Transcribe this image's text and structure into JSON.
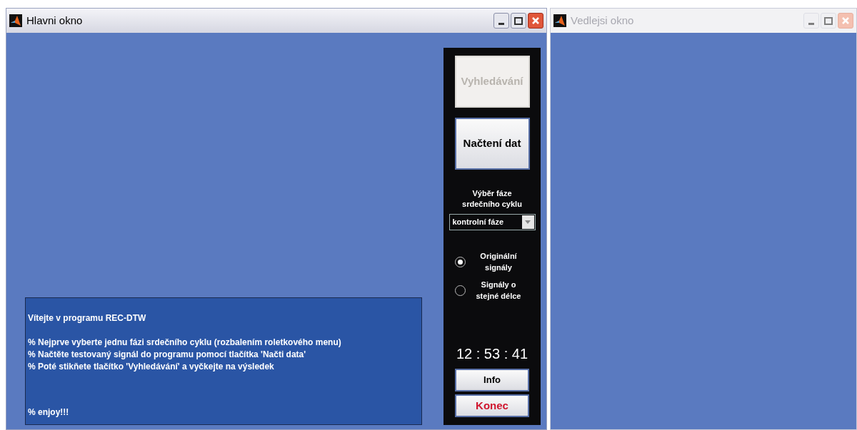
{
  "windows": [
    {
      "title": "Hlavni okno",
      "active": true
    },
    {
      "title": "Vedlejsi okno",
      "active": false
    }
  ],
  "panel": {
    "buttons": [
      {
        "label": "Vyhledávání",
        "disabled": true
      },
      {
        "label": "Načtení dat",
        "disabled": false
      }
    ],
    "phase_label": "Výběr fáze srdečního cyklu",
    "dropdown": {
      "value": "kontrolní fáze"
    },
    "radios": [
      {
        "label": "Originální signály",
        "selected": true
      },
      {
        "label": "Signály o stejné délce",
        "selected": false
      }
    ],
    "clock": "12 : 53 : 41",
    "info_button": "Info",
    "exit_button": "Konec"
  },
  "message_box": {
    "title": "Vítejte v programu REC-DTW",
    "steps": [
      "% Nejprve vyberte jednu fázi srdečního cyklu (rozbalením roletkového menu)",
      "% Načtěte testovaný signál do programu pomocí tlačítka 'Načti data'",
      "% Poté stikňete tlačítko 'Vyhledávání' a vyčkejte na výsledek"
    ],
    "closing": "% enjoy!!!"
  }
}
